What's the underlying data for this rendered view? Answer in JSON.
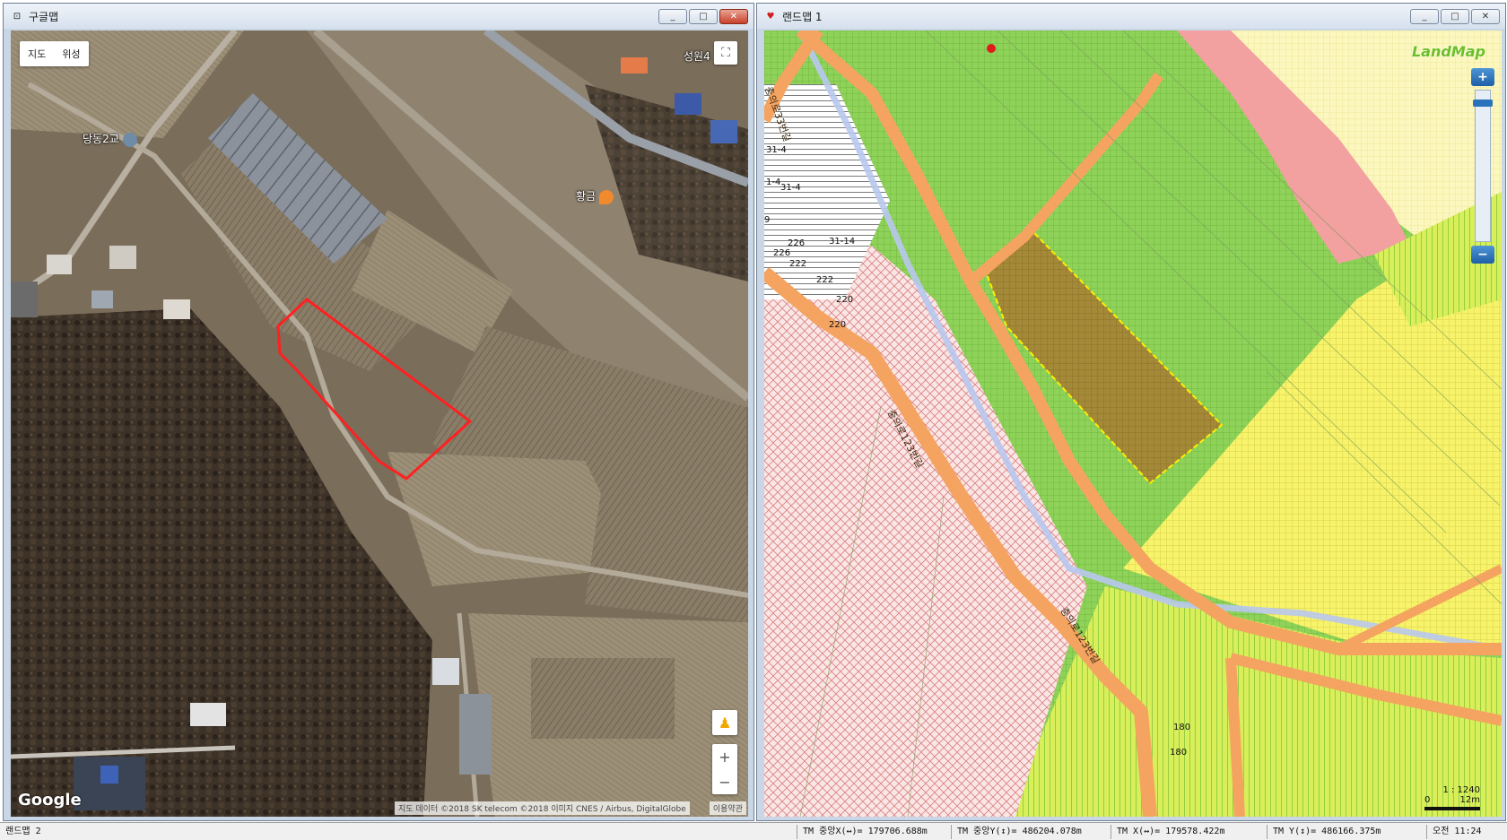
{
  "google_window": {
    "title": "구글맵",
    "map_type": {
      "map_label": "지도",
      "satellite_label": "위성"
    },
    "poi": {
      "bridge": "당동2교",
      "gold": "황금",
      "partial": "성원4"
    },
    "logo": "Google",
    "attribution": "지도 데이터 ©2018 SK telecom ©2018 이미지 CNES / Airbus, DigitalGlobe",
    "terms": "이용약관",
    "zoom_in": "+",
    "zoom_out": "−"
  },
  "land_window": {
    "title": "랜드맵 1",
    "logo": "LandMap",
    "zoom_in": "+",
    "zoom_out": "−",
    "scale_ratio": "1 : 1240",
    "scale_zero": "0",
    "scale_len": "12m",
    "road_labels": [
      "충의로123번길",
      "충의로123번길",
      "충의로33번길"
    ],
    "parcel_numbers": [
      "31-4",
      "31-4",
      "1-4",
      "226",
      "31-14",
      "226",
      "222",
      "222",
      "220",
      "220",
      "180",
      "180",
      "9"
    ]
  },
  "window_buttons": {
    "minimize": "_",
    "maximize": "□",
    "close": "✕"
  },
  "statusbar": {
    "app": "랜드맵 2",
    "tm_center_x": "TM 중앙X(↔)= 179706.688m",
    "tm_center_y": "TM 중앙Y(↕)= 486204.078m",
    "tm_x": "TM X(↔)= 179578.422m",
    "tm_y": "TM Y(↕)= 486166.375m",
    "clock": "오전 11:24"
  },
  "colors": {
    "parcel_outline": "#ff2020",
    "agri_green": "#7ecb4a",
    "pink_zone": "#f2a0a0",
    "yellow_zone": "#f5f04a",
    "road_orange": "#f4a460",
    "selection": "#ffee00"
  }
}
